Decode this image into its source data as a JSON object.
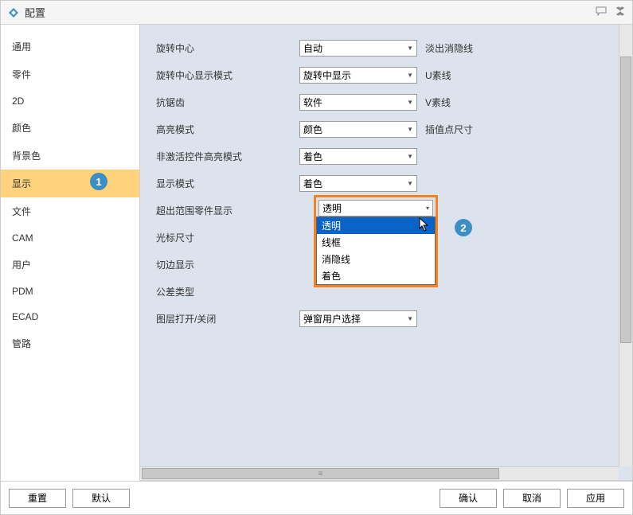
{
  "title": "配置",
  "sidebar": {
    "items": [
      {
        "label": "通用"
      },
      {
        "label": "零件"
      },
      {
        "label": "2D"
      },
      {
        "label": "颜色"
      },
      {
        "label": "背景色"
      },
      {
        "label": "显示"
      },
      {
        "label": "文件"
      },
      {
        "label": "CAM"
      },
      {
        "label": "用户"
      },
      {
        "label": "PDM"
      },
      {
        "label": "ECAD"
      },
      {
        "label": "管路"
      }
    ],
    "active_index": 5
  },
  "badges": {
    "one": "1",
    "two": "2"
  },
  "settings": {
    "rows": [
      {
        "label": "旋转中心",
        "value": "自动",
        "extra": "淡出消隐线"
      },
      {
        "label": "旋转中心显示模式",
        "value": "旋转中显示",
        "extra": "U素线"
      },
      {
        "label": "抗锯齿",
        "value": "软件",
        "extra": "V素线"
      },
      {
        "label": "高亮模式",
        "value": "颜色",
        "extra": "插值点尺寸"
      },
      {
        "label": "非激活控件高亮模式",
        "value": "着色",
        "extra": ""
      },
      {
        "label": "显示模式",
        "value": "着色",
        "extra": ""
      },
      {
        "label": "超出范围零件显示",
        "value": "透明",
        "extra": ""
      },
      {
        "label": "光标尺寸",
        "value": "",
        "extra": ""
      },
      {
        "label": "切边显示",
        "value": "",
        "extra": ""
      },
      {
        "label": "公差类型",
        "value": "",
        "extra": ""
      },
      {
        "label": "图层打开/关闭",
        "value": "弹窗用户选择",
        "extra": ""
      }
    ]
  },
  "dropdown": {
    "header": "透明",
    "items": [
      "透明",
      "线框",
      "消隐线",
      "着色"
    ],
    "selected_index": 0
  },
  "footer": {
    "reset": "重置",
    "default": "默认",
    "ok": "确认",
    "cancel": "取消",
    "apply": "应用"
  }
}
